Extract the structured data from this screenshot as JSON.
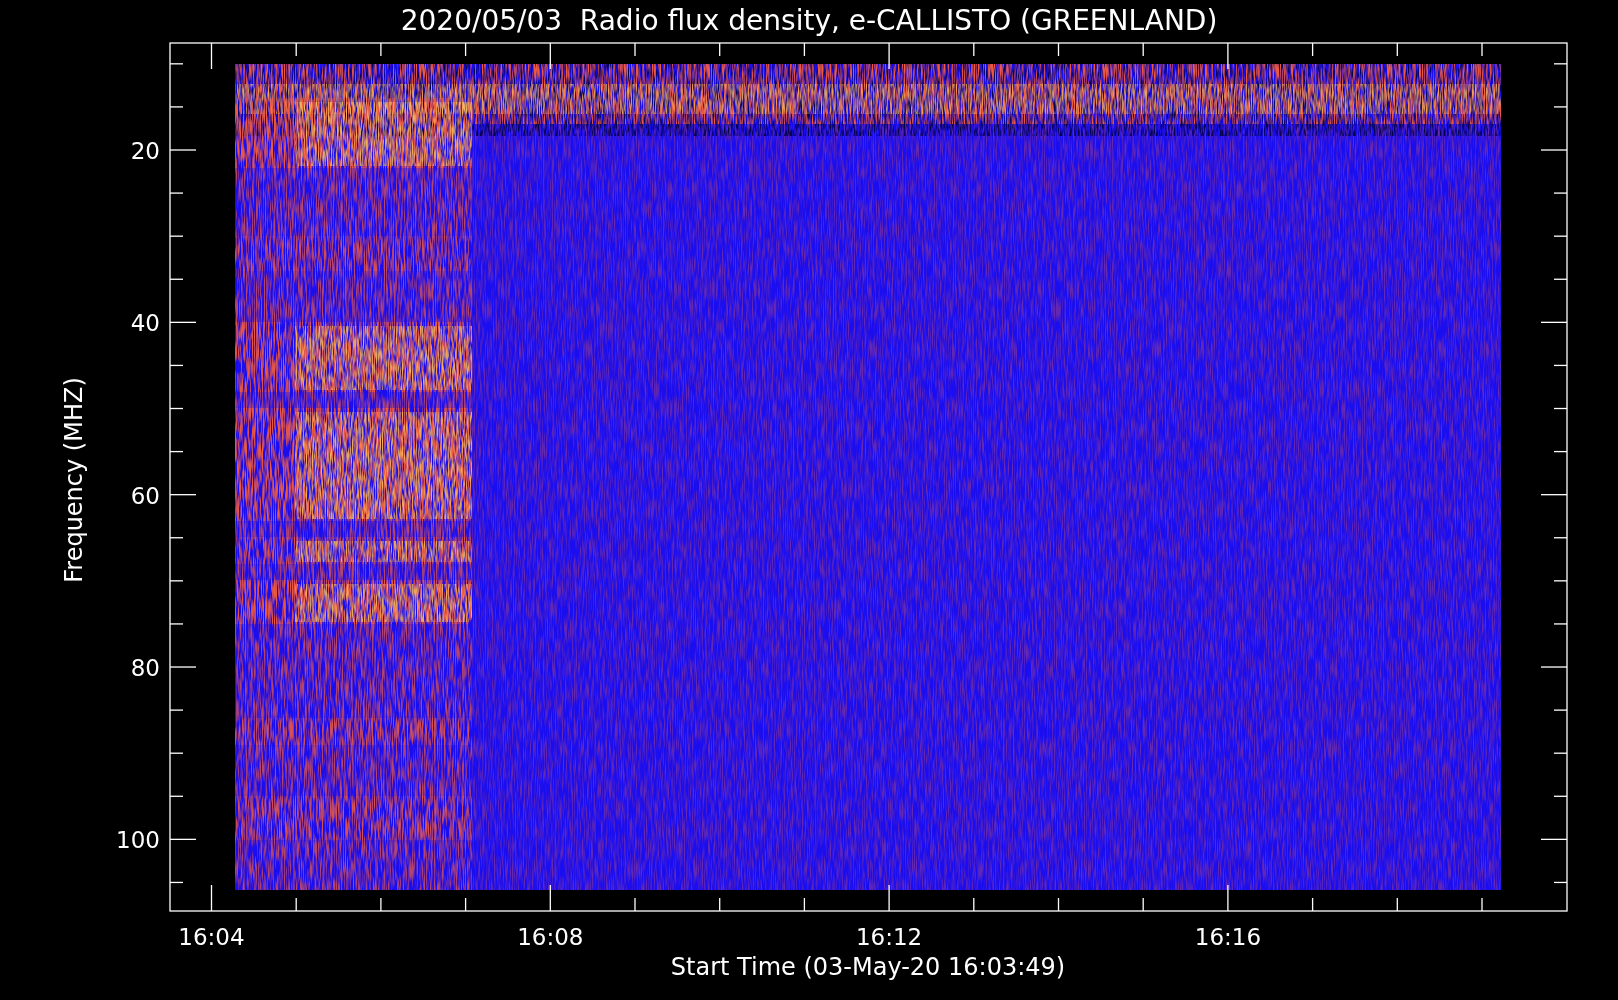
{
  "title": "2020/05/03  Radio flux density, e-CALLISTO (GREENLAND)",
  "y_axis": {
    "label": "Frequency (MHZ)",
    "ticks": [
      "20",
      "40",
      "60",
      "80",
      "100"
    ]
  },
  "x_axis": {
    "label": "Start Time (03-May-20 16:03:49)",
    "ticks": [
      "16:04",
      "16:08",
      "16:12",
      "16:16"
    ]
  }
}
